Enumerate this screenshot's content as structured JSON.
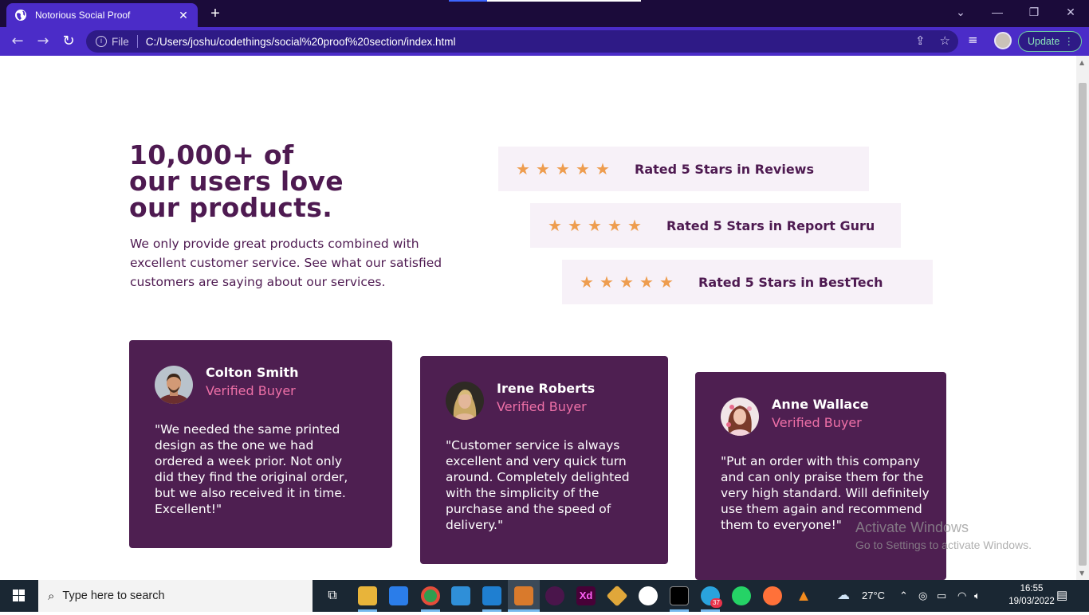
{
  "browser": {
    "tab_title": "Notorious Social Proof",
    "tab_close": "✕",
    "new_tab": "+",
    "url_scheme_label": "File",
    "url": "C:/Users/joshu/codethings/social%20proof%20section/index.html",
    "update_label": "Update",
    "accent_color": "#4b2cc8"
  },
  "hero": {
    "heading_line1": "10,000+ of",
    "heading_line2": "our users love",
    "heading_line3": "our products.",
    "description": "We only provide great products combined with excellent customer service. See what our satisfied customers are saying about our services."
  },
  "ratings": [
    {
      "stars": 5,
      "label": "Rated 5 Stars in Reviews"
    },
    {
      "stars": 5,
      "label": "Rated 5 Stars in Report Guru"
    },
    {
      "stars": 5,
      "label": "Rated 5 Stars in BestTech"
    }
  ],
  "testimonials": [
    {
      "name": "Colton Smith",
      "role": "Verified Buyer",
      "quote": "\"We needed the same printed design as the one we had ordered a week prior. Not only did they find the original order, but we also received it in time. Excellent!\""
    },
    {
      "name": "Irene Roberts",
      "role": "Verified Buyer",
      "quote": "\"Customer service is always excellent and very quick turn around. Completely delighted with the simplicity of the purchase and the speed of delivery.\""
    },
    {
      "name": "Anne Wallace",
      "role": "Verified Buyer",
      "quote": "\"Put an order with this company and can only praise them for the very high standard. Will definitely use them again and recommend them to everyone!\""
    }
  ],
  "watermark": {
    "line1": "Activate Windows",
    "line2": "Go to Settings to activate Windows."
  },
  "taskbar": {
    "search_placeholder": "Type here to search",
    "weather": "27°C",
    "time": "16:55",
    "date": "19/03/2022",
    "telegram_badge": "37",
    "xd_label": "Xd"
  },
  "colors": {
    "primary": "#4e1a51",
    "star": "#ee9d4f",
    "card_bg": "#4e1f51",
    "rating_bg": "#f7f1f8",
    "pink": "#ee70a7"
  }
}
